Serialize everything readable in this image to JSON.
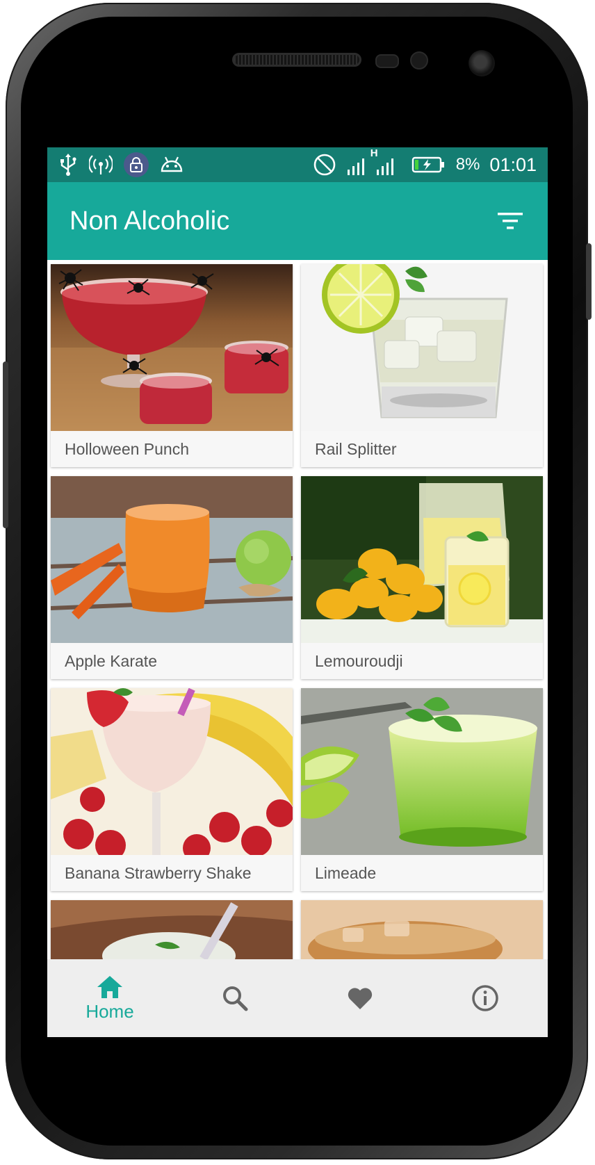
{
  "status_bar": {
    "battery_percent": "8%",
    "time": "01:01",
    "network_type": "H",
    "icons": [
      "usb-icon",
      "hotspot-icon",
      "vpn-lock-icon",
      "android-debug-icon",
      "do-not-disturb-icon",
      "signal-icon",
      "battery-charging-icon"
    ]
  },
  "app_bar": {
    "title": "Non Alcoholic",
    "filter_icon": "filter-list-icon"
  },
  "drinks": [
    {
      "name": "Holloween Punch"
    },
    {
      "name": "Rail Splitter"
    },
    {
      "name": "Apple Karate"
    },
    {
      "name": "Lemouroudji"
    },
    {
      "name": "Banana Strawberry Shake"
    },
    {
      "name": "Limeade"
    }
  ],
  "bottom_nav": {
    "items": [
      {
        "icon": "home-icon",
        "label": "Home",
        "active": true
      },
      {
        "icon": "search-icon",
        "active": false
      },
      {
        "icon": "heart-icon",
        "active": false
      },
      {
        "icon": "info-icon",
        "active": false
      }
    ]
  },
  "colors": {
    "primary": "#17a99a",
    "primary_dark": "#147d72",
    "inactive_icon": "#666666"
  }
}
